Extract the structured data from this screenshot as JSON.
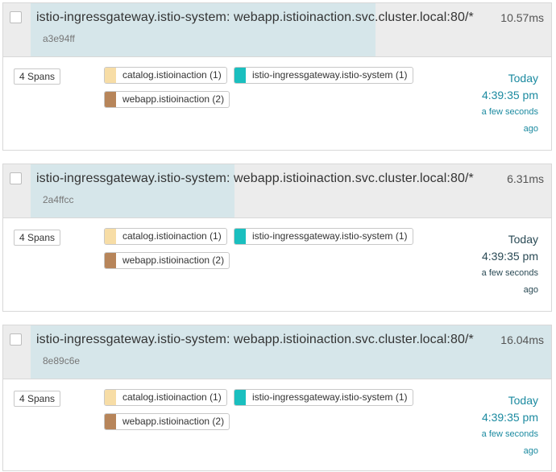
{
  "colors": {
    "catalog_service": "#f7dda6",
    "ingress_service": "#1abfbf",
    "webapp_service": "#b7855a",
    "duration_bar": "#d6e6ea",
    "time_text": "#1b8aa0"
  },
  "traces": [
    {
      "title": "istio-ingressgateway.istio-system: webapp.istioinaction.svc.cluster.local:80/*",
      "trace_id": "a3e94ff",
      "duration": "10.57ms",
      "duration_fraction": 0.66,
      "spans": "4 Spans",
      "services": [
        {
          "label": "catalog.istioinaction (1)",
          "color": "#f7dda6"
        },
        {
          "label": "istio-ingressgateway.istio-system (1)",
          "color": "#1abfbf"
        },
        {
          "label": "webapp.istioinaction (2)",
          "color": "#b7855a"
        }
      ],
      "time": {
        "day": "Today",
        "clock": "4:39:35 pm",
        "relative": "a few seconds",
        "ago": "ago"
      }
    },
    {
      "title": "istio-ingressgateway.istio-system: webapp.istioinaction.svc.cluster.local:80/*",
      "trace_id": "2a4ffcc",
      "duration": "6.31ms",
      "duration_fraction": 0.39,
      "spans": "4 Spans",
      "services": [
        {
          "label": "catalog.istioinaction (1)",
          "color": "#f7dda6"
        },
        {
          "label": "istio-ingressgateway.istio-system (1)",
          "color": "#1abfbf"
        },
        {
          "label": "webapp.istioinaction (2)",
          "color": "#b7855a"
        }
      ],
      "time": {
        "day": "Today",
        "clock": "4:39:35 pm",
        "relative": "a few seconds",
        "ago": "ago"
      }
    },
    {
      "title": "istio-ingressgateway.istio-system: webapp.istioinaction.svc.cluster.local:80/*",
      "trace_id": "8e89c6e",
      "duration": "16.04ms",
      "duration_fraction": 1.0,
      "spans": "4 Spans",
      "services": [
        {
          "label": "catalog.istioinaction (1)",
          "color": "#f7dda6"
        },
        {
          "label": "istio-ingressgateway.istio-system (1)",
          "color": "#1abfbf"
        },
        {
          "label": "webapp.istioinaction (2)",
          "color": "#b7855a"
        }
      ],
      "time": {
        "day": "Today",
        "clock": "4:39:35 pm",
        "relative": "a few seconds",
        "ago": "ago"
      }
    }
  ]
}
